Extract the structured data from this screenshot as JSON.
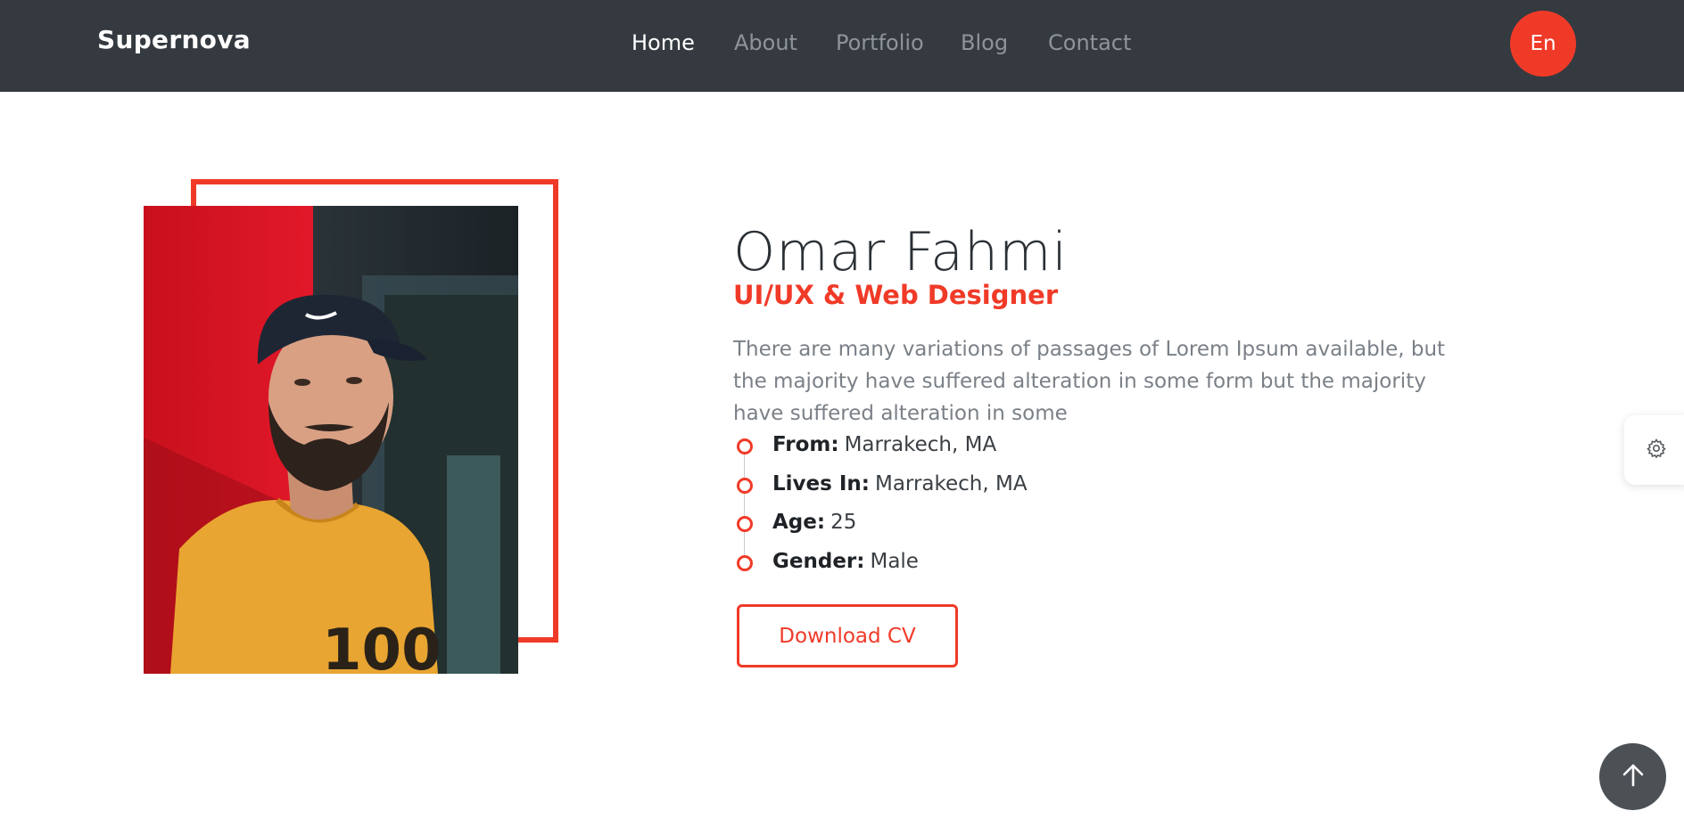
{
  "nav": {
    "brand": "Supernova",
    "links": [
      {
        "label": "Home",
        "active": true
      },
      {
        "label": "About",
        "active": false
      },
      {
        "label": "Portfolio",
        "active": false
      },
      {
        "label": "Blog",
        "active": false
      },
      {
        "label": "Contact",
        "active": false
      }
    ],
    "language": "En"
  },
  "profile": {
    "name": "Omar Fahmi",
    "role": "UI/UX & Web Designer",
    "bio": "There are many variations of passages of Lorem Ipsum available, but the majority have suffered alteration in some form but the majority have suffered alteration in some",
    "details": [
      {
        "label": "From:",
        "value": "Marrakech, MA"
      },
      {
        "label": "Lives In:",
        "value": "Marrakech, MA"
      },
      {
        "label": "Age:",
        "value": "25"
      },
      {
        "label": "Gender:",
        "value": "Male"
      }
    ],
    "cv_button": "Download CV"
  },
  "icons": {
    "settings": "gear-icon",
    "scroll_top": "arrow-up-icon"
  },
  "colors": {
    "accent": "#f03a28",
    "navbar": "#343a40",
    "heading": "#2b3035",
    "body_text": "#7a8087"
  }
}
